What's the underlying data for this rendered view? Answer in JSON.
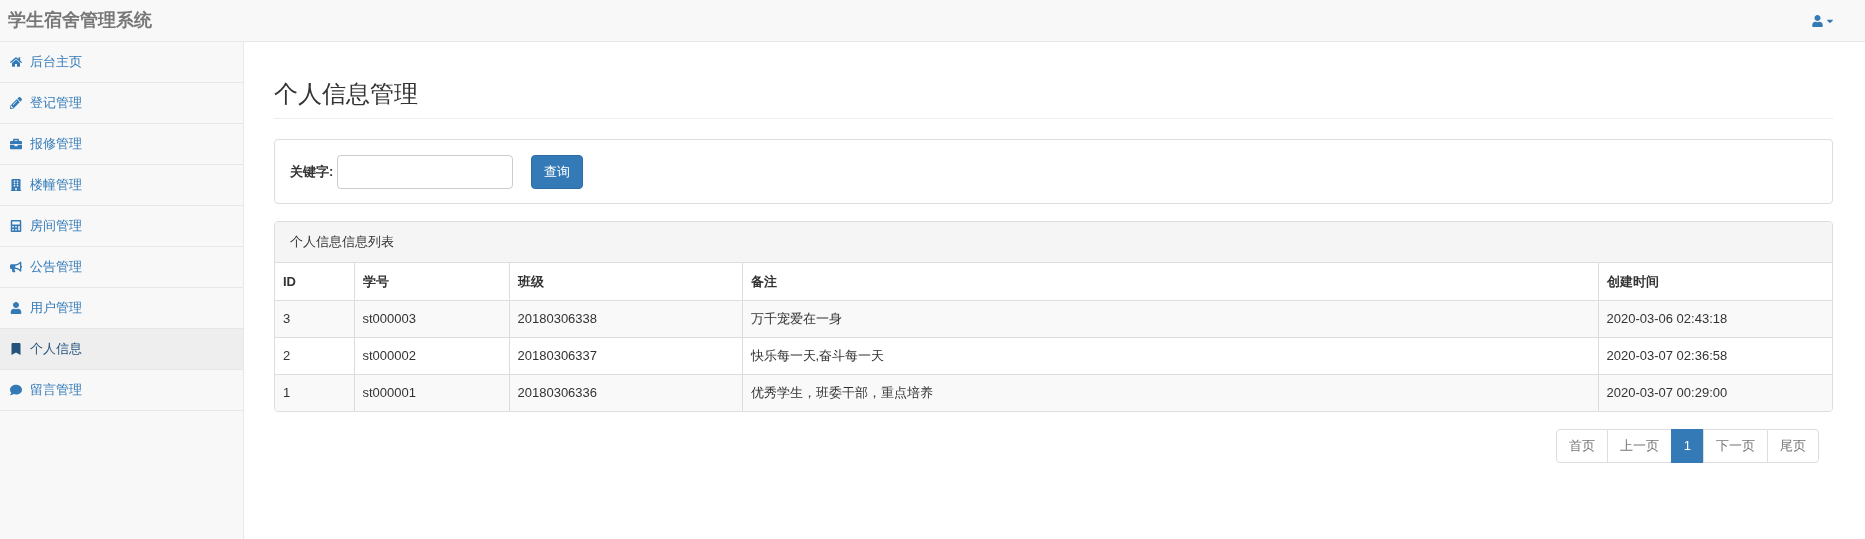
{
  "app_title": "学生宿舍管理系统",
  "sidebar": {
    "items": [
      {
        "label": "后台主页",
        "selected": false
      },
      {
        "label": "登记管理",
        "selected": false
      },
      {
        "label": "报修管理",
        "selected": false
      },
      {
        "label": "楼幢管理",
        "selected": false
      },
      {
        "label": "房间管理",
        "selected": false
      },
      {
        "label": "公告管理",
        "selected": false
      },
      {
        "label": "用户管理",
        "selected": false
      },
      {
        "label": "个人信息",
        "selected": true
      },
      {
        "label": "留言管理",
        "selected": false
      }
    ]
  },
  "page_title": "个人信息管理",
  "search": {
    "label": "关键字:",
    "button": "查询"
  },
  "table": {
    "title": "个人信息信息列表",
    "columns": [
      "ID",
      "学号",
      "班级",
      "备注",
      "创建时间"
    ],
    "rows": [
      [
        "3",
        "st000003",
        "20180306338",
        "万千宠爱在一身",
        "2020-03-06 02:43:18"
      ],
      [
        "2",
        "st000002",
        "20180306337",
        "快乐每一天,奋斗每一天",
        "2020-03-07 02:36:58"
      ],
      [
        "1",
        "st000001",
        "20180306336",
        "优秀学生，班委干部，重点培养",
        "2020-03-07 00:29:00"
      ]
    ]
  },
  "pagination": [
    {
      "label": "首页",
      "selected": false
    },
    {
      "label": "上一页",
      "selected": false
    },
    {
      "label": "1",
      "selected": true
    },
    {
      "label": "下一页",
      "selected": false
    },
    {
      "label": "尾页",
      "selected": false
    }
  ]
}
